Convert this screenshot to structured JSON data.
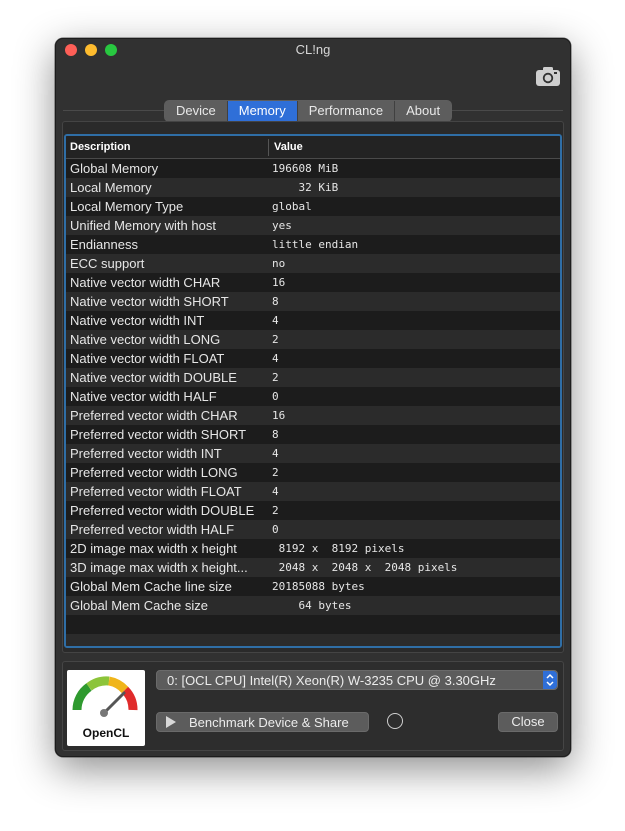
{
  "window": {
    "title": "CL!ng"
  },
  "tabs": [
    {
      "label": "Device",
      "active": false
    },
    {
      "label": "Memory",
      "active": true
    },
    {
      "label": "Performance",
      "active": false
    },
    {
      "label": "About",
      "active": false
    }
  ],
  "table": {
    "columns": [
      "Description",
      "Value"
    ],
    "rows": [
      {
        "desc": "Global Memory",
        "value": "196608 MiB"
      },
      {
        "desc": "Local Memory",
        "value": "    32 KiB"
      },
      {
        "desc": "Local Memory Type",
        "value": "global"
      },
      {
        "desc": "Unified Memory with host",
        "value": "yes"
      },
      {
        "desc": "Endianness",
        "value": "little endian"
      },
      {
        "desc": "ECC support",
        "value": "no"
      },
      {
        "desc": "Native vector width CHAR",
        "value": "16"
      },
      {
        "desc": "Native vector width SHORT",
        "value": "8"
      },
      {
        "desc": "Native vector width INT",
        "value": "4"
      },
      {
        "desc": "Native vector width LONG",
        "value": "2"
      },
      {
        "desc": "Native vector width FLOAT",
        "value": "4"
      },
      {
        "desc": "Native vector width DOUBLE",
        "value": "2"
      },
      {
        "desc": "Native vector width HALF",
        "value": "0"
      },
      {
        "desc": "Preferred vector width CHAR",
        "value": "16"
      },
      {
        "desc": "Preferred vector width SHORT",
        "value": "8"
      },
      {
        "desc": "Preferred vector width INT",
        "value": "4"
      },
      {
        "desc": "Preferred vector width LONG",
        "value": "2"
      },
      {
        "desc": "Preferred vector width FLOAT",
        "value": "4"
      },
      {
        "desc": "Preferred vector width DOUBLE",
        "value": "2"
      },
      {
        "desc": "Preferred vector width HALF",
        "value": "0"
      },
      {
        "desc": "2D image max width x height",
        "value": " 8192 x  8192 pixels"
      },
      {
        "desc": "3D image max width x height...",
        "value": " 2048 x  2048 x  2048 pixels"
      },
      {
        "desc": "Global Mem Cache line size",
        "value": "20185088 bytes"
      },
      {
        "desc": "Global Mem Cache size",
        "value": "    64 bytes"
      },
      {
        "desc": "",
        "value": ""
      },
      {
        "desc": "",
        "value": ""
      }
    ]
  },
  "device_select": {
    "value": "0: [OCL CPU] Intel(R) Xeon(R) W-3235 CPU @ 3.30GHz"
  },
  "buttons": {
    "benchmark_label": "Benchmark Device & Share",
    "close_label": "Close"
  },
  "logo": {
    "label": "OpenCL"
  },
  "colors": {
    "accent": "#2f6fd8",
    "table_border": "#2f6ea6"
  },
  "icons": [
    "camera-icon",
    "play-icon",
    "chevron-updown-icon",
    "opencl-gauge-icon"
  ]
}
